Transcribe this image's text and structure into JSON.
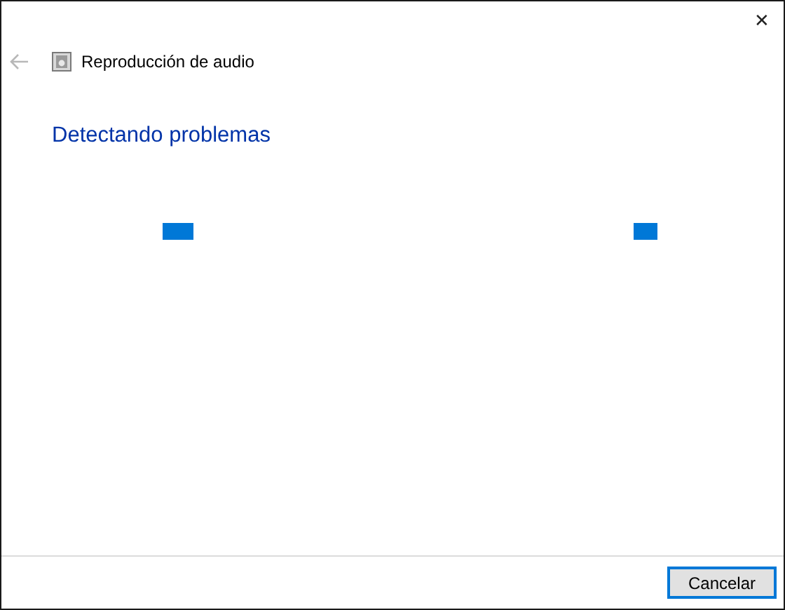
{
  "window": {
    "close": "✕"
  },
  "nav": {
    "back_disabled": true,
    "title": "Reproducción de audio"
  },
  "heading": "Detectando problemas",
  "buttons": [
    {
      "label": "Cancelar",
      "focused": true
    }
  ]
}
